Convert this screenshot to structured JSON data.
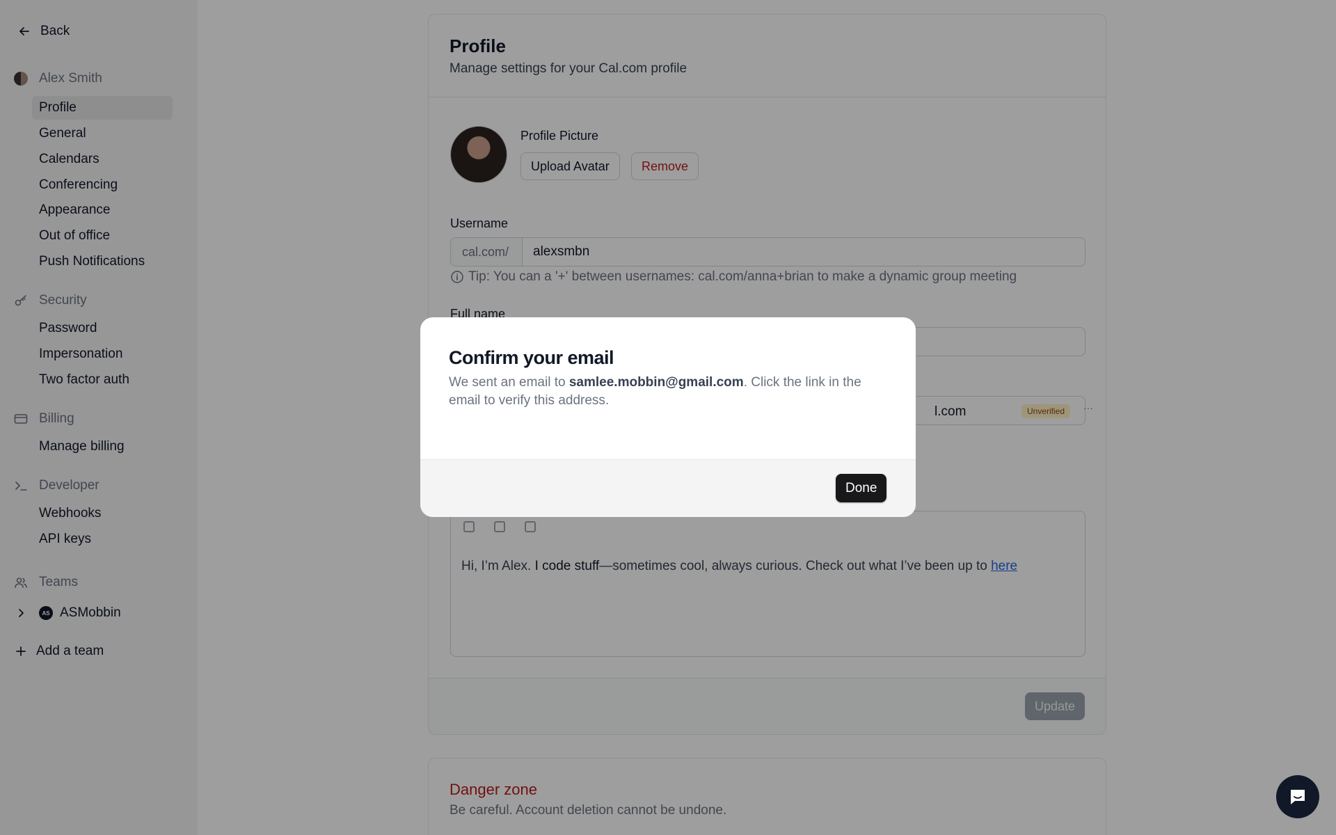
{
  "sidebar": {
    "back_label": "Back",
    "user_name": "Alex Smith",
    "profile_items": [
      "Profile",
      "General",
      "Calendars",
      "Conferencing",
      "Appearance",
      "Out of office",
      "Push Notifications"
    ],
    "security_label": "Security",
    "security_items": [
      "Password",
      "Impersonation",
      "Two factor auth"
    ],
    "billing_label": "Billing",
    "billing_items": [
      "Manage billing"
    ],
    "developer_label": "Developer",
    "developer_items": [
      "Webhooks",
      "API keys"
    ],
    "teams_label": "Teams",
    "team_name": "ASMobbin",
    "team_badge": "AS",
    "add_team_label": "Add a team"
  },
  "profile": {
    "title": "Profile",
    "subtitle": "Manage settings for your Cal.com profile",
    "picture_label": "Profile Picture",
    "upload_label": "Upload Avatar",
    "remove_label": "Remove",
    "username_label": "Username",
    "username_prefix": "cal.com/",
    "username_value": "alexsmbn",
    "tip": "Tip: You can a '+' between usernames: cal.com/anna+brian to make a dynamic group meeting",
    "fullname_label": "Full name",
    "email_tail": "l.com",
    "unverified_badge": "Unverified",
    "email_more": "···",
    "bio": {
      "prefix": "Hi, I’m Alex. ",
      "bold": "I code stuff",
      "middle": "—sometimes cool, always curious. Check out what I’ve been up to ",
      "link": "here"
    },
    "update_label": "Update"
  },
  "danger": {
    "title": "Danger zone",
    "subtitle": "Be careful. Account deletion cannot be undone."
  },
  "modal": {
    "title": "Confirm your email",
    "body_prefix": "We sent an email to ",
    "email": "samlee.mobbin@gmail.com",
    "body_suffix": ". Click the link in the email to verify this address.",
    "done_label": "Done"
  },
  "colors": {
    "danger": "#b91c1c",
    "unverified_bg": "#fef3c7",
    "primary_button": "#18181b"
  }
}
